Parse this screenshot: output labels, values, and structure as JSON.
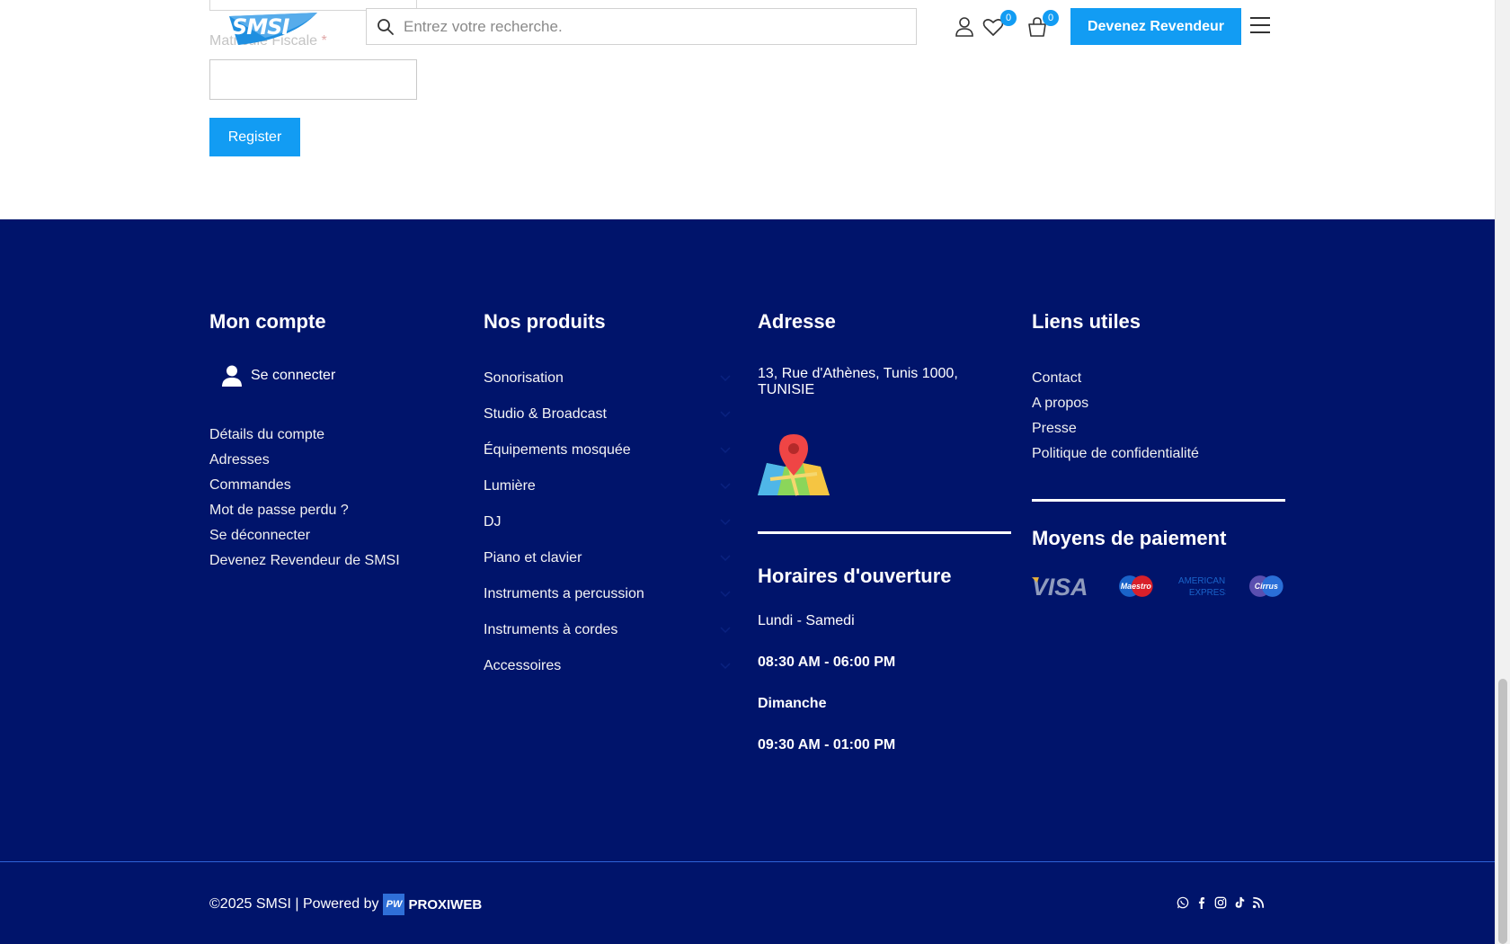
{
  "form": {
    "field_label": "Matricule Fiscale",
    "required_mark": "*",
    "register_label": "Register"
  },
  "header": {
    "logo_text": "SMSI",
    "search_placeholder": "Entrez votre recherche.",
    "wishlist_count": "0",
    "cart_count": "0",
    "reseller_button": "Devenez Revendeur",
    "accent_color": "#129cf3"
  },
  "footer": {
    "background_color": "#00146b",
    "account": {
      "title": "Mon compte",
      "login_label": "Se connecter",
      "links": [
        "Détails du compte",
        "Adresses",
        "Commandes",
        "Mot de passe perdu ?",
        "Se déconnecter",
        "Devenez Revendeur de SMSI"
      ]
    },
    "products": {
      "title": "Nos produits",
      "items": [
        "Sonorisation",
        "Studio & Broadcast",
        "Équipements mosquée",
        "Lumière",
        "DJ",
        "Piano et clavier",
        "Instruments a percussion",
        "Instruments à cordes",
        "Accessoires"
      ]
    },
    "address": {
      "title": "Adresse",
      "text": "13, Rue d'Athènes, Tunis 1000, TUNISIE",
      "map_icon": "map-pin-icon"
    },
    "hours": {
      "title": "Horaires d'ouverture",
      "weekday_label": "Lundi - Samedi",
      "weekday_hours": "08:30 AM - 06:00 PM",
      "sunday_label": "Dimanche",
      "sunday_hours": "09:30 AM - 01:00 PM"
    },
    "useful": {
      "title": "Liens utiles",
      "links": [
        "Contact",
        "A propos",
        "Presse",
        "Politique de confidentialité"
      ]
    },
    "payment": {
      "title": "Moyens de paiement",
      "methods": [
        "VISA",
        "Maestro",
        "AMERICAN EXPRESS",
        "Cirrus"
      ]
    },
    "bottom": {
      "copyright": "©2025 SMSI | Powered by",
      "powered_logo_mark": "PW",
      "powered_name": "PROXIWEB",
      "socials": [
        "whatsapp-icon",
        "facebook-icon",
        "instagram-icon",
        "tiktok-icon",
        "rss-icon"
      ]
    }
  }
}
